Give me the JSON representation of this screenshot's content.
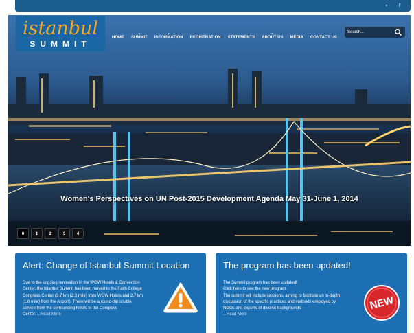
{
  "topbar": {
    "social": [
      {
        "name": "rss-icon",
        "glyph": "▪"
      },
      {
        "name": "facebook-icon",
        "glyph": "f"
      }
    ]
  },
  "logo": {
    "top": "istanbul",
    "bottom": "SUMMIT"
  },
  "nav": {
    "items": [
      "HOME",
      "SUMMIT",
      "INFORMATION",
      "REGISTRATION",
      "STATEMENTS",
      "ABOUT US",
      "MEDIA",
      "CONTACT US"
    ],
    "carets": [
      false,
      true,
      true,
      false,
      false,
      true,
      false,
      false
    ]
  },
  "search": {
    "placeholder": "Search..."
  },
  "hero": {
    "caption": "Women's Perspectives on UN Post-2015 Development Agenda May 31-June 1, 2014",
    "pager": [
      "0",
      "1",
      "2",
      "3",
      "4"
    ]
  },
  "alert_card": {
    "title": "Alert: Change of Istanbul Summit Location",
    "lines": [
      "Due to the ongoing renovation in the WOW Hotels & Convention",
      "Center, the Istanbul Summit has been moved to the Fatih College",
      "Congress Center (3.7 km (2.3 mile) from WOW Hotels and 2.7 km",
      "(1.6 mile) from the Airport). There will be a round-trip shuttle",
      "service from the surrounding hotels to the Congress",
      "Center. "
    ],
    "read_more": "...Read More",
    "icon": "warning-icon"
  },
  "program_card": {
    "title": "The program has been updated!",
    "lines": [
      "The Summit program has been updated!",
      "Click here to see the new program.",
      "The summit will include sessions, aiming to facilitate an in-depth",
      "discussion of the specific practices and methods employed by",
      "NGOs and experts of diverse backgrounds"
    ],
    "read_more": "...Read More",
    "badge": "NEW"
  },
  "colors": {
    "brand_blue": "#1d6fb3",
    "accent_orange": "#f7a823",
    "new_red": "#d8282e"
  }
}
